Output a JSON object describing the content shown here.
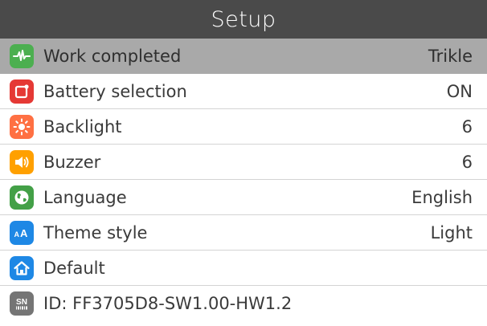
{
  "title": "Setup",
  "colors": {
    "titlebar": "#4a4a4a",
    "selected_row": "#a9a9a9",
    "work_icon": "#4caf50",
    "battery_icon": "#e53935",
    "backlight_icon": "#ff7043",
    "buzzer_icon": "#ffa000",
    "language_icon": "#43a047",
    "theme_icon": "#1e88e5",
    "default_icon": "#1e88e5",
    "id_icon": "#757575"
  },
  "rows": [
    {
      "label": "Work completed",
      "value": "Trikle",
      "icon": "waveform-icon",
      "selected": true
    },
    {
      "label": "Battery selection",
      "value": "ON",
      "icon": "battery-square-icon"
    },
    {
      "label": "Backlight",
      "value": "6",
      "icon": "sun-icon"
    },
    {
      "label": "Buzzer",
      "value": "6",
      "icon": "speaker-icon"
    },
    {
      "label": "Language",
      "value": "English",
      "icon": "globe-icon"
    },
    {
      "label": "Theme style",
      "value": "Light",
      "icon": "text-size-icon"
    },
    {
      "label": "Default",
      "value": "",
      "icon": "home-icon"
    },
    {
      "label": "ID: FF3705D8-SW1.00-HW1.2",
      "value": "",
      "icon": "sn-barcode-icon",
      "icon_text": "SN"
    }
  ]
}
